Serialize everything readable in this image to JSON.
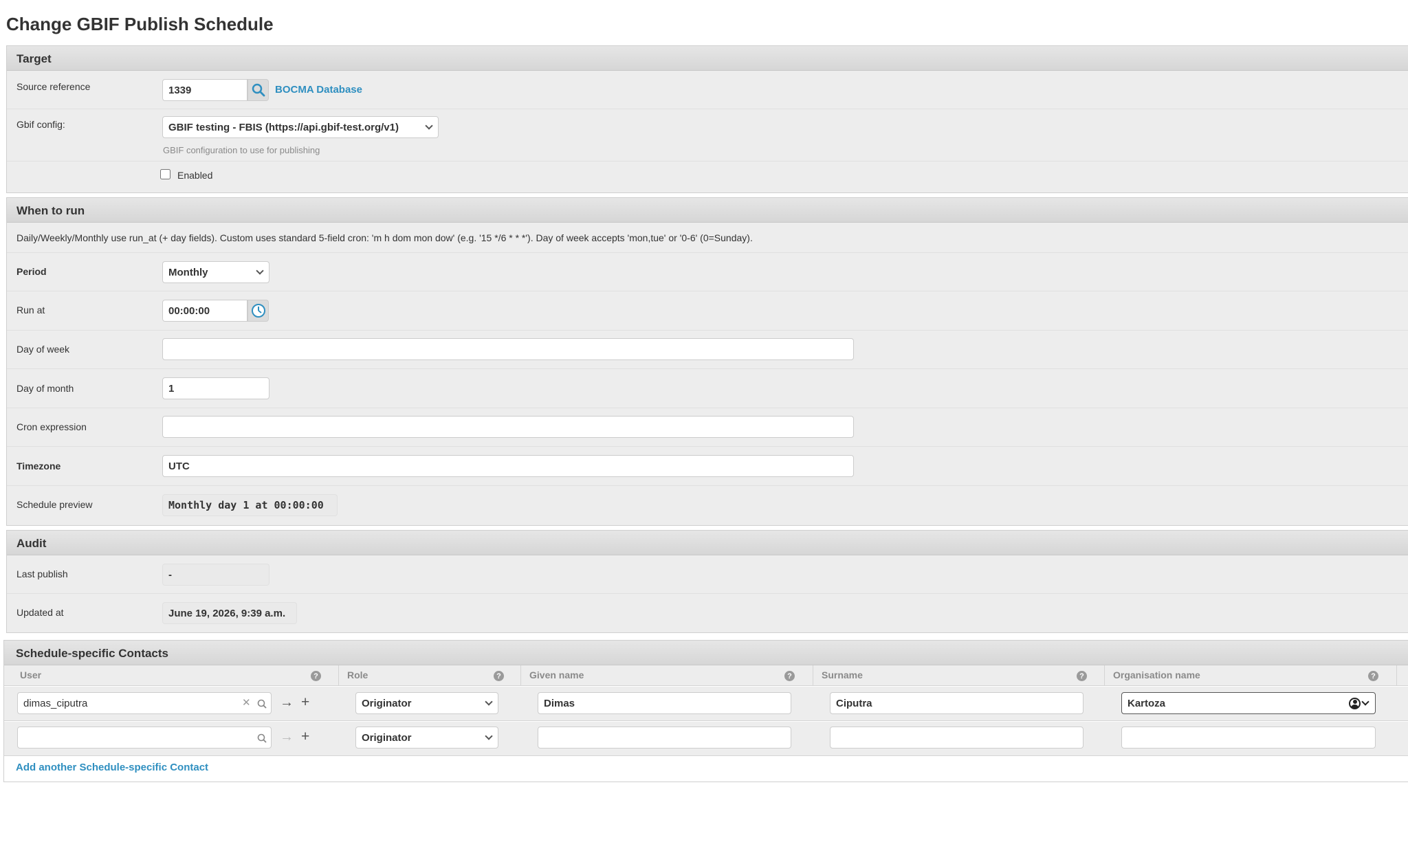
{
  "page": {
    "title": "Change GBIF Publish Schedule"
  },
  "target": {
    "header": "Target",
    "source_reference": {
      "label": "Source reference",
      "value": "1339",
      "link_text": "BOCMA Database"
    },
    "gbif_config": {
      "label": "Gbif config:",
      "selected": "GBIF testing - FBIS (https://api.gbif-test.org/v1)",
      "help": "GBIF configuration to use for publishing"
    },
    "enabled": {
      "label": "Enabled",
      "checked": false
    }
  },
  "when_to_run": {
    "header": "When to run",
    "description": "Daily/Weekly/Monthly use run_at (+ day fields). Custom uses standard 5-field cron: 'm h dom mon dow' (e.g. '15 */6 * * *'). Day of week accepts 'mon,tue' or '0-6' (0=Sunday).",
    "period": {
      "label": "Period",
      "selected": "Monthly"
    },
    "run_at": {
      "label": "Run at",
      "value": "00:00:00"
    },
    "day_of_week": {
      "label": "Day of week",
      "value": ""
    },
    "day_of_month": {
      "label": "Day of month",
      "value": "1"
    },
    "cron_expression": {
      "label": "Cron expression",
      "value": ""
    },
    "timezone": {
      "label": "Timezone",
      "value": "UTC"
    },
    "schedule_preview": {
      "label": "Schedule preview",
      "value": "Monthly day 1 at 00:00:00"
    }
  },
  "audit": {
    "header": "Audit",
    "last_publish": {
      "label": "Last publish",
      "value": "-"
    },
    "updated_at": {
      "label": "Updated at",
      "value": "June 19, 2026, 9:39 a.m."
    }
  },
  "contacts": {
    "header": "Schedule-specific Contacts",
    "columns": [
      "User",
      "Role",
      "Given name",
      "Surname",
      "Organisation name"
    ],
    "rows": [
      {
        "user": "dimas_ciputra",
        "role": "Originator",
        "given_name": "Dimas",
        "surname": "Ciputra",
        "organisation": "Kartoza"
      },
      {
        "user": "",
        "role": "Originator",
        "given_name": "",
        "surname": "",
        "organisation": ""
      }
    ],
    "add_link": "Add another Schedule-specific Contact"
  },
  "colors": {
    "link": "#2f8fc0",
    "panel": "#ededed",
    "header": "#d9d9d9"
  },
  "icons": [
    "search-icon",
    "clock-icon",
    "help-icon",
    "clear-icon",
    "arrow-right-icon",
    "plus-icon",
    "user-circle-icon",
    "chevron-down-icon"
  ]
}
